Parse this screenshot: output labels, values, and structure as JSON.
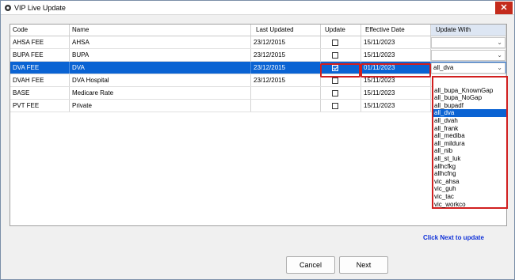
{
  "window": {
    "title": "VIP Live Update",
    "close_label": "✕"
  },
  "grid": {
    "columns": [
      "Code",
      "Name",
      "Last Updated",
      "Update",
      "Effective Date",
      "Update With"
    ],
    "rows": [
      {
        "code": "AHSA FEE",
        "name": "AHSA",
        "last_updated": "23/12/2015",
        "update": false,
        "effective_date": "15/11/2023",
        "update_with": ""
      },
      {
        "code": "BUPA FEE",
        "name": "BUPA",
        "last_updated": "23/12/2015",
        "update": false,
        "effective_date": "15/11/2023",
        "update_with": ""
      },
      {
        "code": "DVA FEE",
        "name": "DVA",
        "last_updated": "23/12/2015",
        "update": true,
        "effective_date": "01/11/2023",
        "update_with": "all_dva"
      },
      {
        "code": "DVAH FEE",
        "name": "DVA Hospital",
        "last_updated": "23/12/2015",
        "update": false,
        "effective_date": "15/11/2023",
        "update_with": ""
      },
      {
        "code": "BASE",
        "name": "Medicare Rate",
        "last_updated": "",
        "update": false,
        "effective_date": "15/11/2023",
        "update_with": ""
      },
      {
        "code": "PVT FEE",
        "name": "Private",
        "last_updated": "",
        "update": false,
        "effective_date": "15/11/2023",
        "update_with": ""
      }
    ],
    "selected_row": 2
  },
  "dropdown": {
    "options": [
      "",
      "all_bupa_KnownGap",
      "all_bupa_NoGap",
      "all_bupadf",
      "all_dva",
      "all_dvah",
      "all_frank",
      "all_mediba",
      "all_mildura",
      "all_nib",
      "all_st_luk",
      "allhcfkg",
      "allhcfng",
      "vic_ahsa",
      "vic_guh",
      "vic_tac",
      "vic_workco"
    ],
    "selected": "all_dva"
  },
  "hint": "Click Next to update",
  "buttons": {
    "cancel": "Cancel",
    "next": "Next"
  },
  "colors": {
    "selection": "#0a63d3",
    "highlight": "#d11f1f",
    "hint": "#0d2fd8"
  }
}
